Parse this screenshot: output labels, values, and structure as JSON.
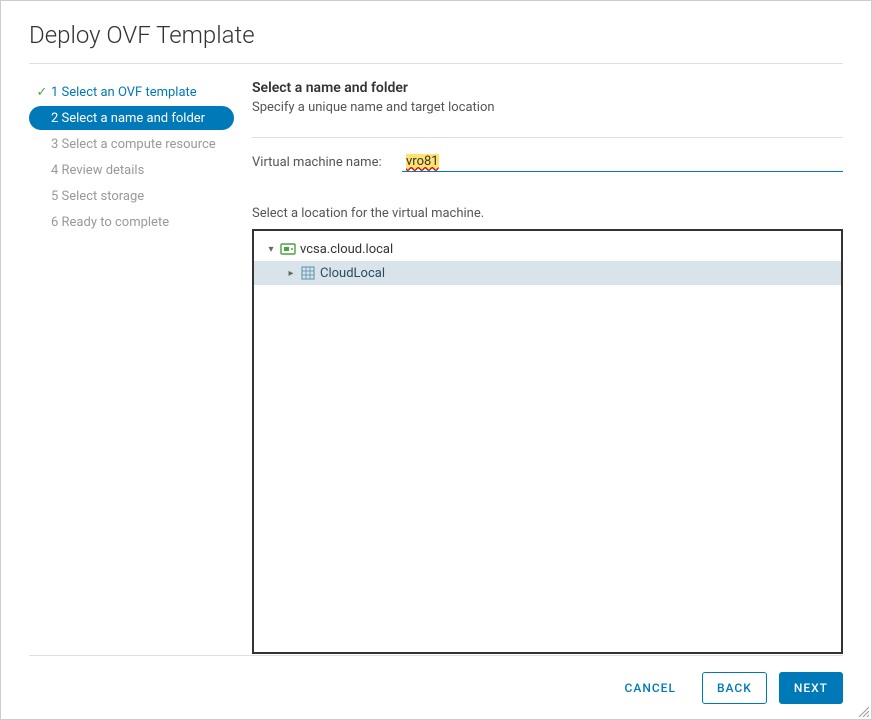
{
  "dialog": {
    "title": "Deploy OVF Template"
  },
  "steps": [
    {
      "label": "1 Select an OVF template",
      "state": "completed"
    },
    {
      "label": "2 Select a name and folder",
      "state": "active"
    },
    {
      "label": "3 Select a compute resource",
      "state": "pending"
    },
    {
      "label": "4 Review details",
      "state": "pending"
    },
    {
      "label": "5 Select storage",
      "state": "pending"
    },
    {
      "label": "6 Ready to complete",
      "state": "pending"
    }
  ],
  "main": {
    "section_title": "Select a name and folder",
    "section_sub": "Specify a unique name and target location",
    "vm_name_label": "Virtual machine name:",
    "vm_name_value": "vro81",
    "location_label": "Select a location for the virtual machine."
  },
  "tree": {
    "root": {
      "label": "vcsa.cloud.local",
      "expanded": true
    },
    "child": {
      "label": "CloudLocal",
      "expanded": false,
      "selected": true
    }
  },
  "footer": {
    "cancel": "CANCEL",
    "back": "BACK",
    "next": "NEXT"
  },
  "icons": {
    "check": "✓",
    "twisty_open": "▾",
    "twisty_closed": "▸"
  }
}
